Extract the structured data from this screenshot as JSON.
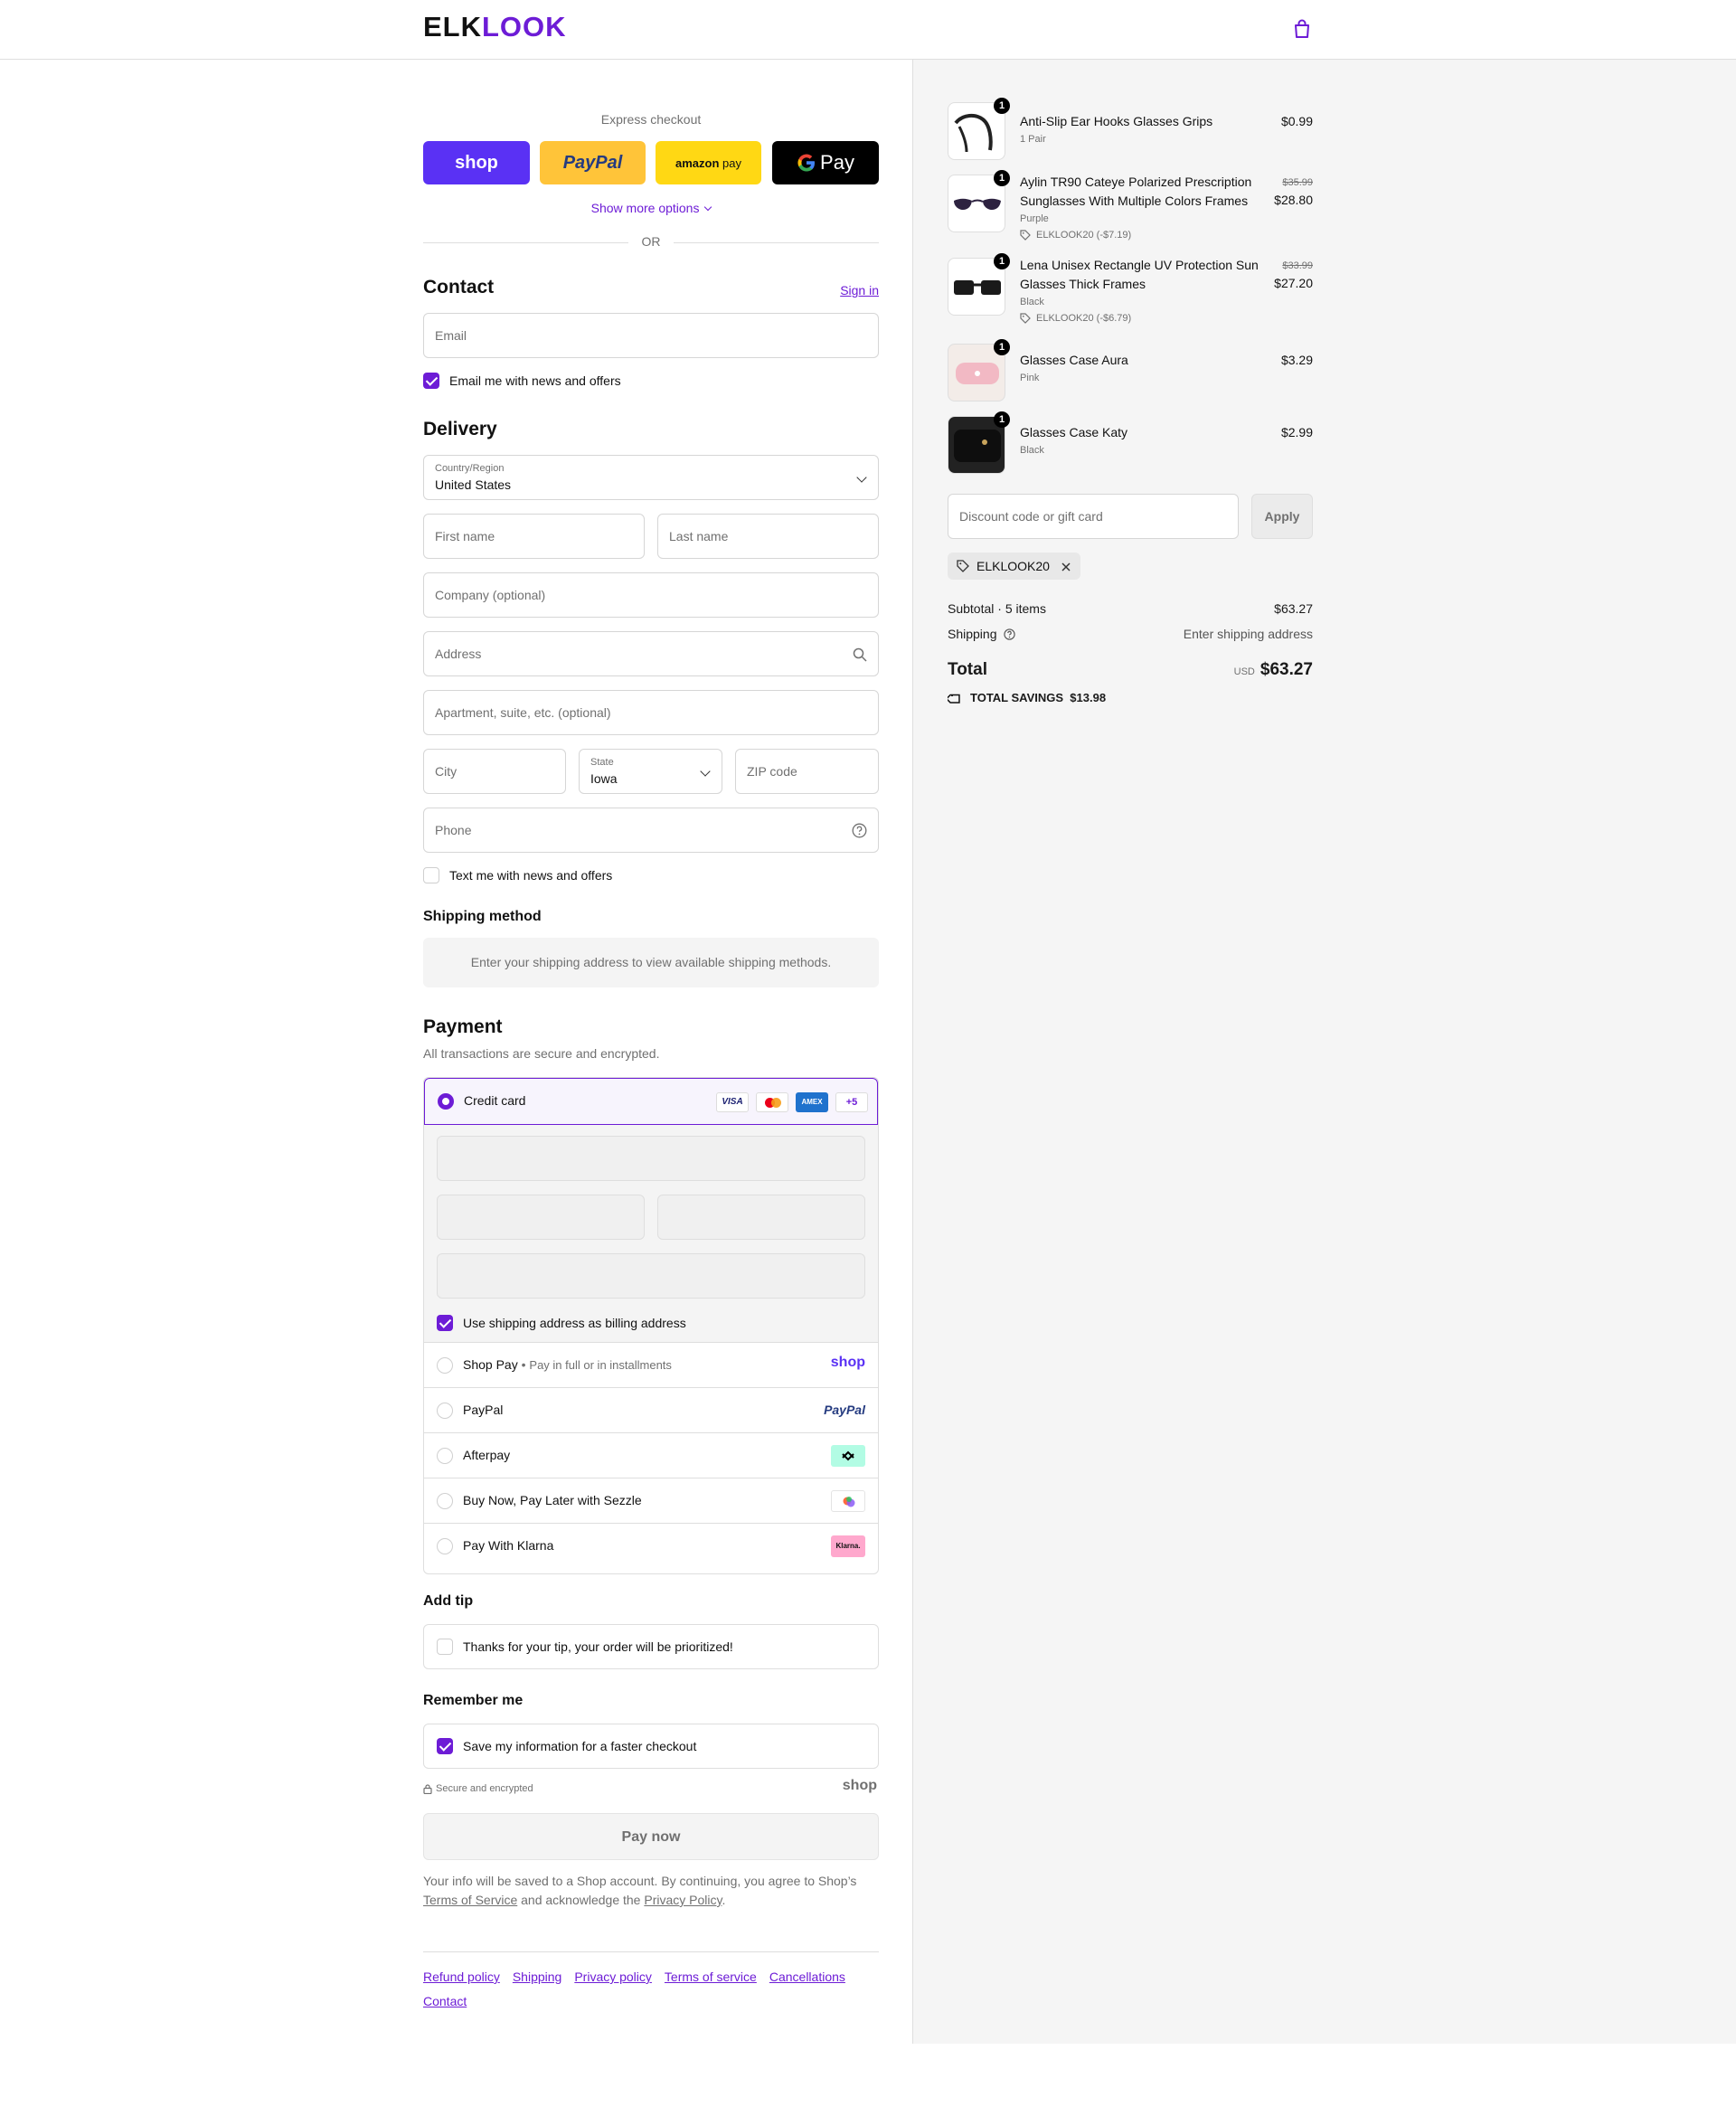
{
  "header": {
    "logo_a": "ELK",
    "logo_b": "LOOK"
  },
  "express": {
    "label": "Express checkout",
    "shop": "shop",
    "paypal": "PayPal",
    "amazon_a": "amazon",
    "amazon_b": "pay",
    "gpay": "Pay",
    "more": "Show more options",
    "or": "OR"
  },
  "contact": {
    "title": "Contact",
    "signin": "Sign in",
    "email_ph": "Email",
    "news": "Email me with news and offers"
  },
  "delivery": {
    "title": "Delivery",
    "country_label": "Country/Region",
    "country": "United States",
    "first": "First name",
    "last": "Last name",
    "company": "Company (optional)",
    "address": "Address",
    "apt": "Apartment, suite, etc. (optional)",
    "city": "City",
    "state_label": "State",
    "state": "Iowa",
    "zip": "ZIP code",
    "phone": "Phone",
    "text_news": "Text me with news and offers"
  },
  "shipping": {
    "title": "Shipping method",
    "info": "Enter your shipping address to view available shipping methods."
  },
  "payment": {
    "title": "Payment",
    "subtitle": "All transactions are secure and encrypted.",
    "cc": "Credit card",
    "visa": "VISA",
    "amex": "AMEX",
    "plus": "+5",
    "billing": "Use shipping address as billing address",
    "shoppay": "Shop Pay",
    "shoppay_sub": "Pay in full or in installments",
    "shop_logo": "shop",
    "paypal": "PayPal",
    "paypal_logo": "PayPal",
    "afterpay": "Afterpay",
    "sezzle": "Buy Now, Pay Later with Sezzle",
    "klarna": "Pay With Klarna",
    "klarna_logo": "Klarna."
  },
  "tip": {
    "title": "Add tip",
    "label": "Thanks for your tip, your order will be prioritized!"
  },
  "remember": {
    "title": "Remember me",
    "label": "Save my information for a faster checkout",
    "secure": "Secure and encrypted",
    "shop": "shop"
  },
  "pay_button": "Pay now",
  "legal": {
    "t1": "Your info will be saved to a Shop account. By continuing, you agree to Shop’s",
    "tos": "Terms of Service",
    "t2": "and acknowledge the",
    "privacy": "Privacy Policy",
    "t3": "."
  },
  "footer": [
    "Refund policy",
    "Shipping",
    "Privacy policy",
    "Terms of service",
    "Cancellations",
    "Contact"
  ],
  "cart": {
    "items": [
      {
        "qty": "1",
        "name": "Anti-Slip Ear Hooks Glasses Grips",
        "variant": "1 Pair",
        "price": "$0.99"
      },
      {
        "qty": "1",
        "name": "Aylin TR90 Cateye Polarized Prescription Sunglasses With Multiple Colors Frames",
        "variant": "Purple",
        "discount": "ELKLOOK20 (-$7.19)",
        "old": "$35.99",
        "price": "$28.80"
      },
      {
        "qty": "1",
        "name": "Lena Unisex Rectangle UV Protection Sun Glasses Thick Frames",
        "variant": "Black",
        "discount": "ELKLOOK20 (-$6.79)",
        "old": "$33.99",
        "price": "$27.20"
      },
      {
        "qty": "1",
        "name": "Glasses Case Aura",
        "variant": "Pink",
        "price": "$3.29"
      },
      {
        "qty": "1",
        "name": "Glasses Case Katy",
        "variant": "Black",
        "price": "$2.99"
      }
    ],
    "discount_ph": "Discount code or gift card",
    "apply": "Apply",
    "code": "ELKLOOK20",
    "subtotal_label": "Subtotal · 5 items",
    "subtotal": "$63.27",
    "shipping_label": "Shipping",
    "shipping_val": "Enter shipping address",
    "total_label": "Total",
    "currency": "USD",
    "total": "$63.27",
    "savings_label": "TOTAL SAVINGS",
    "savings": "$13.98"
  }
}
